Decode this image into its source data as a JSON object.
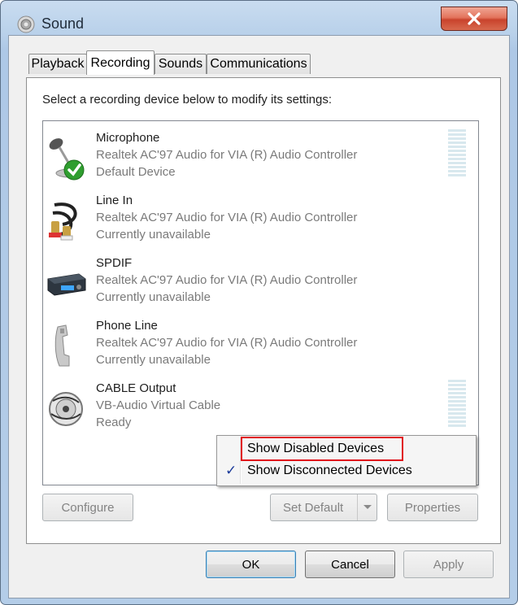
{
  "window": {
    "title": "Sound",
    "close_label": "×"
  },
  "tabs": [
    {
      "label": "Playback",
      "active": false
    },
    {
      "label": "Recording",
      "active": true
    },
    {
      "label": "Sounds",
      "active": false
    },
    {
      "label": "Communications",
      "active": false
    }
  ],
  "recording": {
    "instruction": "Select a recording device below to modify its settings:",
    "devices": [
      {
        "name": "Microphone",
        "driver": "Realtek AC'97 Audio for VIA (R) Audio Controller",
        "status": "Default Device",
        "icon": "microphone-icon",
        "default": true
      },
      {
        "name": "Line In",
        "driver": "Realtek AC'97 Audio for VIA (R) Audio Controller",
        "status": "Currently unavailable",
        "icon": "line-in-cable-icon"
      },
      {
        "name": "SPDIF",
        "driver": "Realtek AC'97 Audio for VIA (R) Audio Controller",
        "status": "Currently unavailable",
        "icon": "spdif-receiver-icon"
      },
      {
        "name": "Phone Line",
        "driver": "Realtek AC'97 Audio for VIA (R) Audio Controller",
        "status": "Currently unavailable",
        "icon": "phone-handset-icon"
      },
      {
        "name": "CABLE Output",
        "driver": "VB-Audio Virtual Cable",
        "status": "Ready",
        "icon": "cable-reel-icon"
      }
    ]
  },
  "context_menu": {
    "items": [
      {
        "label": "Show Disabled Devices",
        "checked": false
      },
      {
        "label": "Show Disconnected Devices",
        "checked": true
      }
    ],
    "highlight_color": "#e0121b"
  },
  "buttons": {
    "configure": "Configure",
    "set_default": "Set Default",
    "properties": "Properties",
    "ok": "OK",
    "cancel": "Cancel",
    "apply": "Apply"
  },
  "colors": {
    "accent": "#3c7fb1",
    "check": "#1a3a9a",
    "close": "#c9432c"
  }
}
